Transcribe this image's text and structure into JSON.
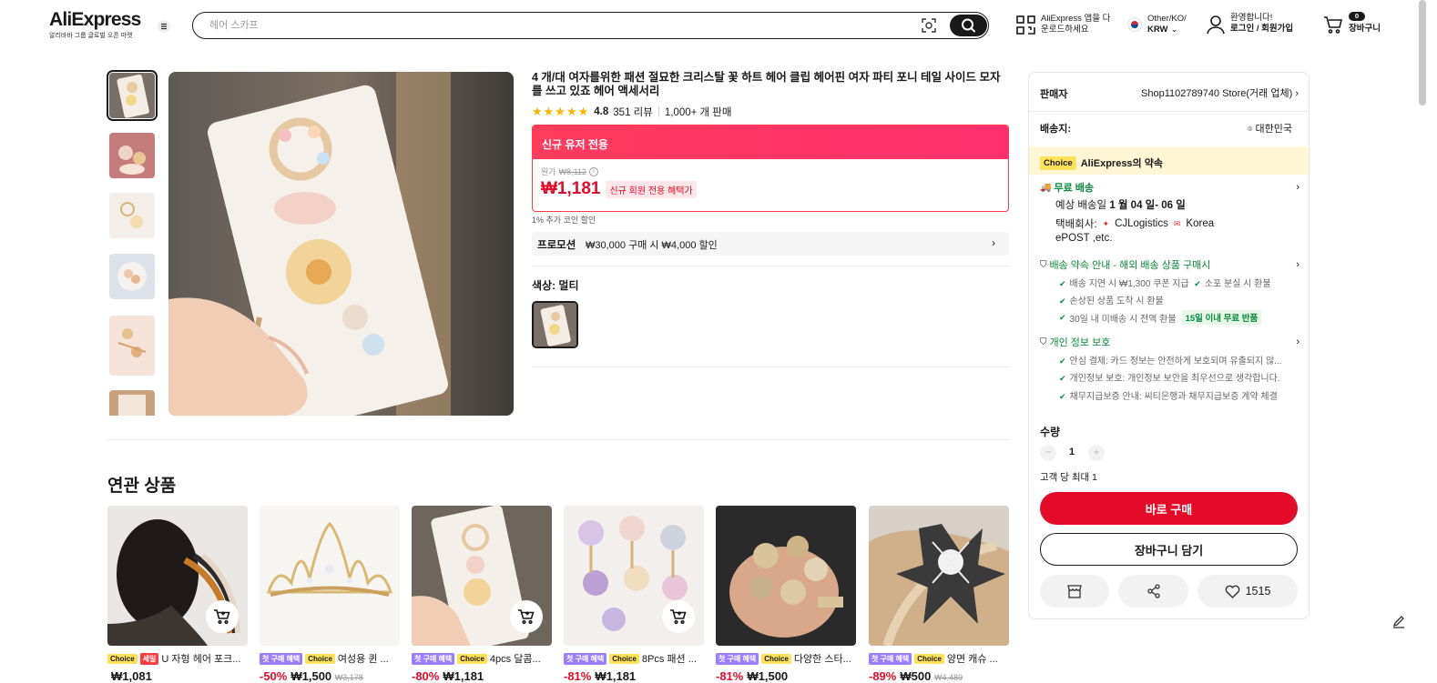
{
  "header": {
    "brand": "AliExpress",
    "brand_sub": "알리바바 그룹 글로벌 오픈 마켓",
    "search_placeholder": "헤어 스카프",
    "app_line1": "AliExpress 앱을 다",
    "app_line2": "운로드하세요",
    "locale_line1": "Other/KO/",
    "locale_line2": "KRW",
    "greet_line1": "환영합니다!",
    "greet_line2": "로그인 / 회원가입",
    "cart_count": "0",
    "cart_label": "장바구니"
  },
  "product": {
    "title": "4 개/대 여자를위한 패션 절묘한 크리스탈 꽃 하트 헤어 클립 헤어핀 여자 파티 포니 테일 사이드 모자를 쓰고 있죠 헤어 액세서리",
    "rating": "4.8",
    "reviews": "351 리뷰",
    "sold": "1,000+ 개 판매",
    "new_user_header": "신규 유저 전용",
    "orig_label": "원가",
    "orig_price": "₩8,112",
    "price": "₩1,181",
    "price_tag": "신규 회원 전용 혜택가",
    "coin_note": "1% 추가 코인 할인",
    "promo_label": "프로모션",
    "promo_text": "₩30,000 구매 시 ₩4,000 할인",
    "color_label": "색상: 멀티"
  },
  "panel": {
    "seller_label": "판매자",
    "seller_name": "Shop1102789740 Store(거래 업체)",
    "ship_label": "배송지:",
    "ship_to": "대한민국",
    "choice_badge": "Choice",
    "choice_promise": "AliExpress의 약속",
    "free_ship": "무료 배송",
    "delivery_prefix": "예상 배송일",
    "delivery_dates": "1 월 04 일- 06 일",
    "carrier_label": "택배회사:",
    "carrier1": "CJLogistics",
    "carrier2": "Korea",
    "carrier3": "ePOST ,etc.",
    "guarantee_title": "배송 약속 안내 - 해외 배송 상품 구매시",
    "g1": "배송 지연 시 ₩1,300 쿠폰 지급",
    "g2": "소포 분실 시 환불",
    "g3": "손상된 상품 도착 시 환불",
    "g4": "30일 내 미배송 시 전액 환불",
    "g4_badge": "15일 이내 무료 반품",
    "privacy_title": "개인 정보 보호",
    "p1": "안심 결제: 카드 정보는 안전하게 보호되며 유출되지 않...",
    "p2": "개인정보 보호: 개인정보 보안을 최우선으로 생각합니다.",
    "p3": "채무지급보증 안내: 씨티은행과 채무지급보증 계약 체결",
    "qty_label": "수량",
    "qty_value": "1",
    "qty_limit": "고객 당 최대 1",
    "buy_now": "바로 구매",
    "add_cart": "장바구니 담기",
    "wish_count": "1515"
  },
  "related": {
    "title": "연관 상품",
    "badge_choice": "Choice",
    "badge_sale": "세일",
    "badge_first": "첫 구매 혜택",
    "items": [
      {
        "name": "U 자형 헤어 포크...",
        "discount": "",
        "price": "₩1,081",
        "orig": ""
      },
      {
        "name": "여성용 퀸 ...",
        "discount": "-50%",
        "price": "₩1,500",
        "orig": "₩3,178"
      },
      {
        "name": "4pcs 달콤...",
        "discount": "-80%",
        "price": "₩1,181",
        "orig": ""
      },
      {
        "name": "8Pcs 패션 ...",
        "discount": "-81%",
        "price": "₩1,181",
        "orig": ""
      },
      {
        "name": "다양한 스타...",
        "discount": "-81%",
        "price": "₩1,500",
        "orig": ""
      },
      {
        "name": "양면 캐슈 ...",
        "discount": "-89%",
        "price": "₩500",
        "orig": "₩4,489"
      }
    ]
  },
  "colors": {
    "accent_red": "#e50a2a",
    "choice_yellow": "#ffe15a",
    "green": "#0a8a3a",
    "first_purchase": "#9b7dff"
  }
}
